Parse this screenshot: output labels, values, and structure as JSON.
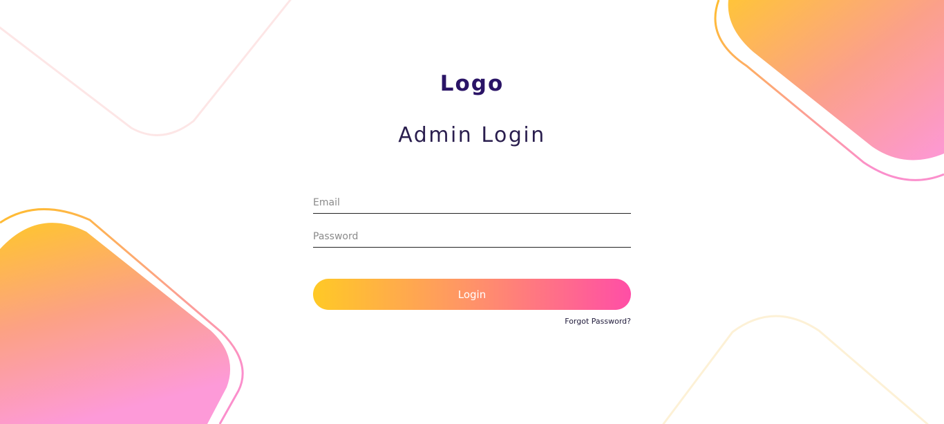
{
  "brand": {
    "logo_text": "Logo"
  },
  "login": {
    "heading": "Admin Login",
    "email_placeholder": "Email",
    "password_placeholder": "Password",
    "submit_label": "Login",
    "forgot_password_link": "Forgot Password?"
  },
  "theme": {
    "gradient_start": "#ffc926",
    "gradient_mid": "#ff9566",
    "gradient_end": "#ff4ea6",
    "title_color": "#2a1466"
  }
}
